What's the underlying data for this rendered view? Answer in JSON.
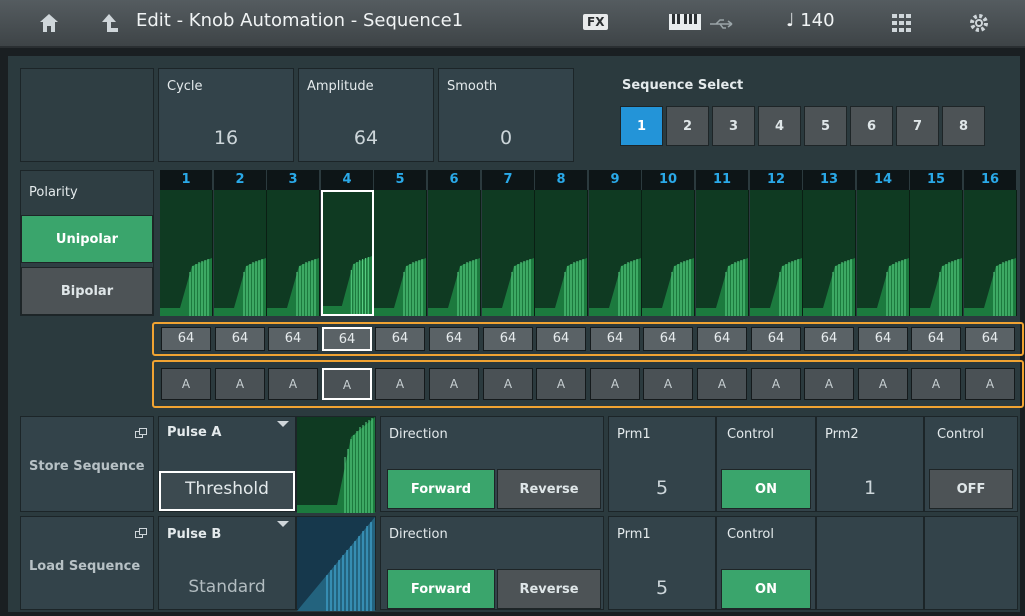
{
  "header": {
    "title": "Edit - Knob Automation - Sequence1",
    "fx_label": "FX",
    "tempo": "♩ 140"
  },
  "params": {
    "cycle": {
      "label": "Cycle",
      "value": "16"
    },
    "amplitude": {
      "label": "Amplitude",
      "value": "64"
    },
    "smooth": {
      "label": "Smooth",
      "value": "0"
    }
  },
  "sequence_select": {
    "label": "Sequence Select",
    "buttons": [
      "1",
      "2",
      "3",
      "4",
      "5",
      "6",
      "7",
      "8"
    ],
    "selected": "1"
  },
  "polarity": {
    "label": "Polarity",
    "unipolar": "Unipolar",
    "bipolar": "Bipolar",
    "selected": "Unipolar"
  },
  "steps": {
    "numbers": [
      "1",
      "2",
      "3",
      "4",
      "5",
      "6",
      "7",
      "8",
      "9",
      "10",
      "11",
      "12",
      "13",
      "14",
      "15",
      "16"
    ],
    "values": [
      "64",
      "64",
      "64",
      "64",
      "64",
      "64",
      "64",
      "64",
      "64",
      "64",
      "64",
      "64",
      "64",
      "64",
      "64",
      "64"
    ],
    "types": [
      "A",
      "A",
      "A",
      "A",
      "A",
      "A",
      "A",
      "A",
      "A",
      "A",
      "A",
      "A",
      "A",
      "A",
      "A",
      "A"
    ]
  },
  "store_sequence": "Store Sequence",
  "load_sequence": "Load Sequence",
  "pulse_a": {
    "label": "Pulse A",
    "value": "Threshold",
    "direction_label": "Direction",
    "forward": "Forward",
    "reverse": "Reverse",
    "prm1_label": "Prm1",
    "prm1_value": "5",
    "control1_label": "Control",
    "control1_value": "ON",
    "prm2_label": "Prm2",
    "prm2_value": "1",
    "control2_label": "Control",
    "control2_value": "OFF"
  },
  "pulse_b": {
    "label": "Pulse B",
    "value": "Standard",
    "direction_label": "Direction",
    "forward": "Forward",
    "reverse": "Reverse",
    "prm1_label": "Prm1",
    "prm1_value": "5",
    "control1_label": "Control",
    "control1_value": "ON"
  },
  "colors": {
    "accent_blue": "#2394d8",
    "accent_green": "#3aa56c",
    "highlight_orange": "#f0a332"
  }
}
